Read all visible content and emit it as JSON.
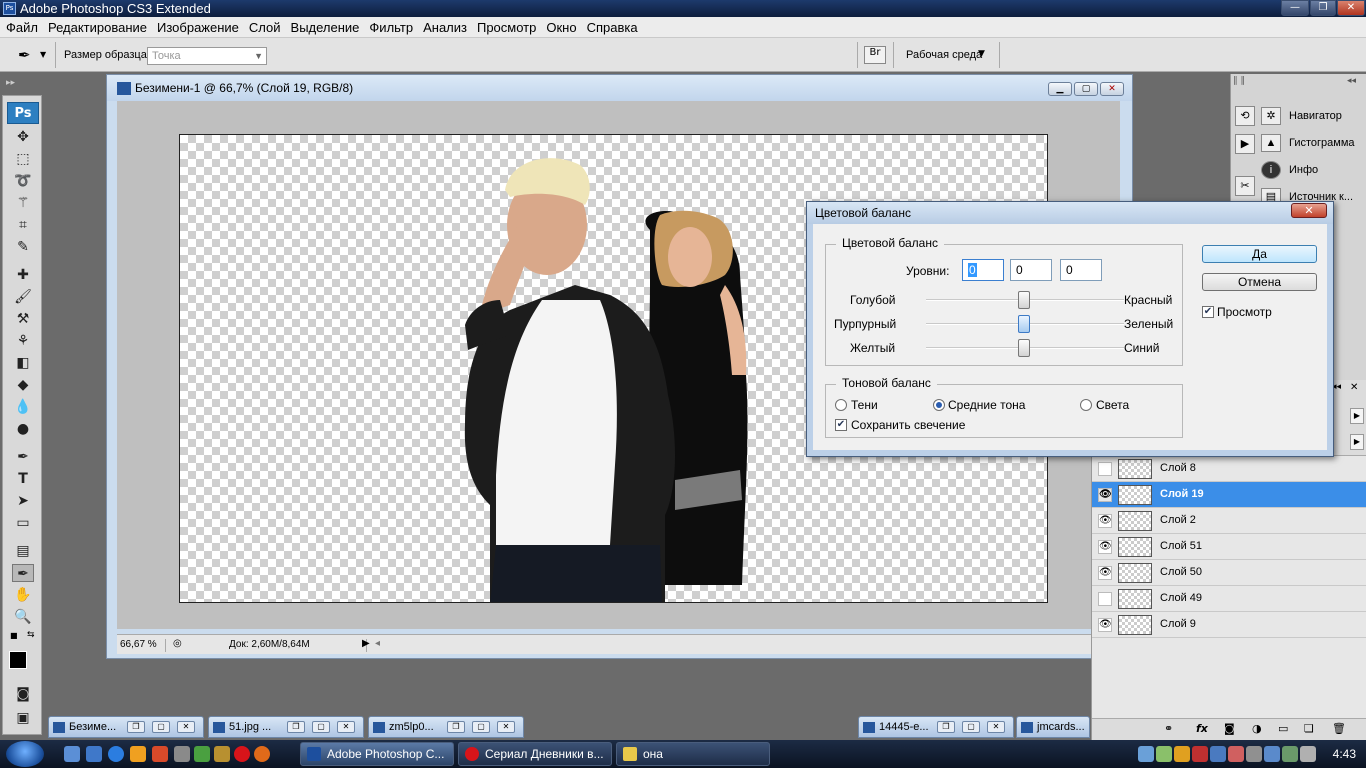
{
  "app": {
    "title": "Adobe Photoshop CS3 Extended",
    "logo": "Ps"
  },
  "menu": [
    "Файл",
    "Редактирование",
    "Изображение",
    "Слой",
    "Выделение",
    "Фильтр",
    "Анализ",
    "Просмотр",
    "Окно",
    "Справка"
  ],
  "options": {
    "sample_size_label": "Размер образца:",
    "sample_size_value": "Точка",
    "workspace_label": "Рабочая среда"
  },
  "document": {
    "title": "Безимени-1 @ 66,7% (Слой 19, RGB/8)",
    "zoom": "66,67 %",
    "doc_info": "Док: 2,60M/8,64M"
  },
  "dock_panels": [
    {
      "label": "Навигатор",
      "icon": "navigator-icon"
    },
    {
      "label": "Гистограмма",
      "icon": "histogram-icon"
    },
    {
      "label": "Инфо",
      "icon": "info-icon"
    },
    {
      "label": "Источник к...",
      "icon": "clone-source-icon"
    }
  ],
  "layers": [
    {
      "name": "Слой 8",
      "visible": false,
      "selected": false
    },
    {
      "name": "Слой 19",
      "visible": true,
      "selected": true
    },
    {
      "name": "Слой 2",
      "visible": true,
      "selected": false
    },
    {
      "name": "Слой 51",
      "visible": true,
      "selected": false
    },
    {
      "name": "Слой 50",
      "visible": true,
      "selected": false
    },
    {
      "name": "Слой 49",
      "visible": false,
      "selected": false
    },
    {
      "name": "Слой 9",
      "visible": true,
      "selected": false
    }
  ],
  "dialog": {
    "title": "Цветовой баланс",
    "group_color": "Цветовой баланс",
    "levels_label": "Уровни:",
    "levels": [
      "0",
      "0",
      "0"
    ],
    "sliders": [
      {
        "left": "Голубой",
        "right": "Красный",
        "value": 0
      },
      {
        "left": "Пурпурный",
        "right": "Зеленый",
        "value": 0
      },
      {
        "left": "Желтый",
        "right": "Синий",
        "value": 0
      }
    ],
    "group_tone": "Тоновой баланс",
    "tones": [
      "Тени",
      "Средние тона",
      "Света"
    ],
    "selected_tone": "Средние тона",
    "preserve_luminosity": "Сохранить свечение",
    "preserve_checked": true,
    "ok": "Да",
    "cancel": "Отмена",
    "preview": "Просмотр",
    "preview_checked": true
  },
  "minimized_docs": [
    "Безиме...",
    "51.jpg ...",
    "zm5lp0...",
    "14445-e...",
    "jmcards..."
  ],
  "taskbar": {
    "items": [
      {
        "label": "Adobe Photoshop C...",
        "active": true
      },
      {
        "label": "Сериал Дневники в...",
        "active": false
      },
      {
        "label": "она",
        "active": false
      }
    ],
    "clock": "4:43"
  },
  "colors": {
    "accent": "#3b8ee8",
    "titlebar": "#1d3a6c",
    "dialog_frame": "#bcd0e8"
  }
}
